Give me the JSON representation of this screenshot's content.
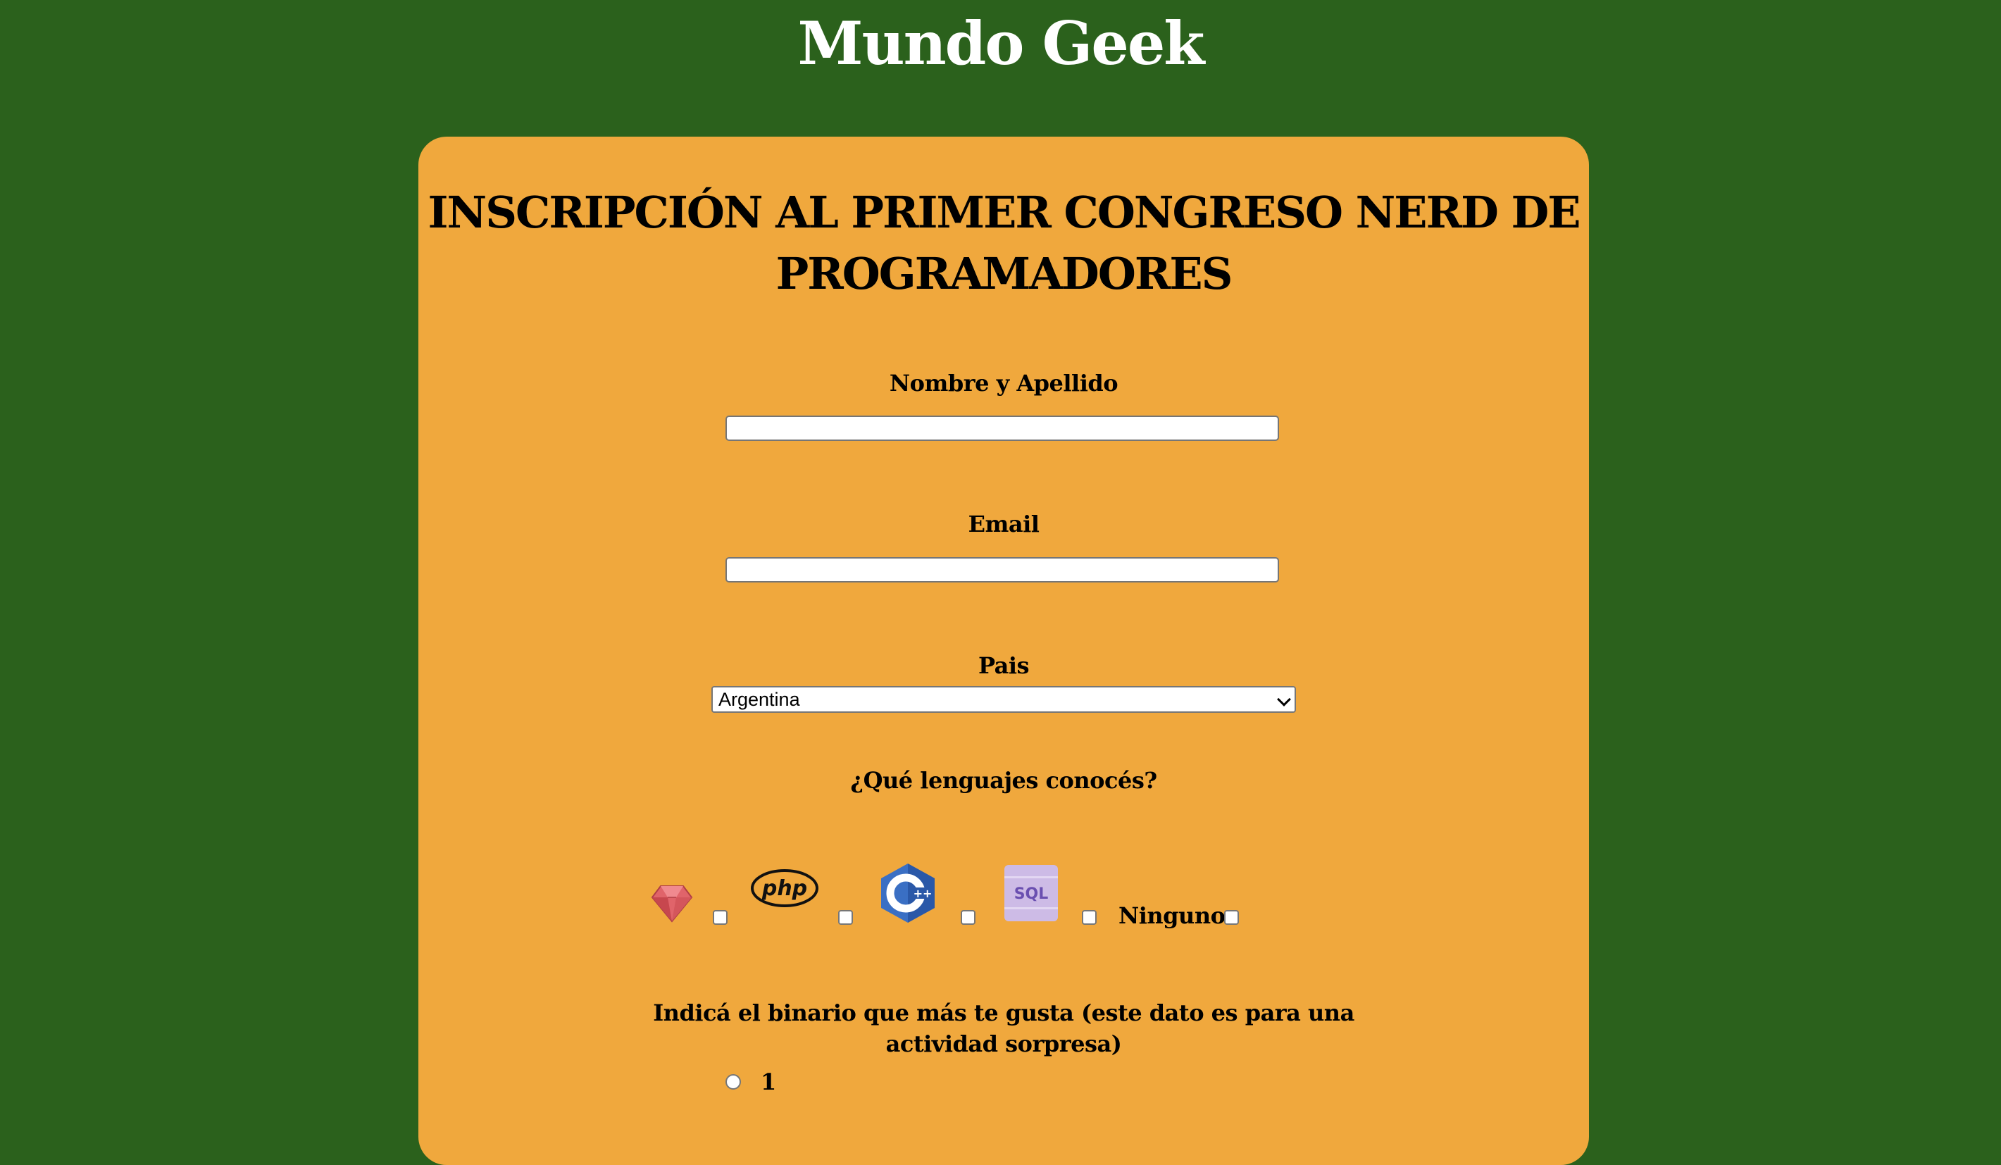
{
  "site": {
    "title": "Mundo Geek"
  },
  "form": {
    "title_line1": "INSCRIPCIÓN AL PRIMER CONGRESO NERD DE",
    "title_line2": "PROGRAMADORES",
    "name_label": "Nombre y Apellido",
    "name_value": "",
    "email_label": "Email",
    "email_value": "",
    "country_label": "Pais",
    "country_selected": "Argentina",
    "languages_label": "¿Qué lenguajes conocés?",
    "languages": [
      {
        "icon": "ruby-icon",
        "checked": false
      },
      {
        "icon": "php-icon",
        "checked": false
      },
      {
        "icon": "cpp-icon",
        "checked": false
      },
      {
        "icon": "sql-icon",
        "checked": false
      },
      {
        "label": "Ninguno",
        "checked": false
      }
    ],
    "binary_label_line1": "Indicá el binario que más te gusta (este dato es para una",
    "binary_label_line2": "actividad sorpresa)",
    "binary_options": [
      "1"
    ]
  },
  "colors": {
    "page_background": "#2b611c",
    "card_background": "#f0a83d",
    "title_text": "#ffffff"
  }
}
